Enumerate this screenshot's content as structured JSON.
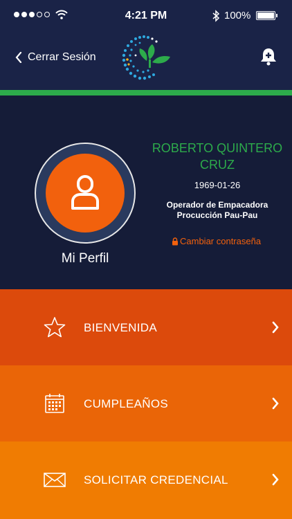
{
  "status_bar": {
    "time": "4:21 PM",
    "battery_percent": "100%",
    "signal_bars": 3
  },
  "nav": {
    "back_label": "Cerrar Sesión",
    "logo_icon": "logo-dots-leaf",
    "bell_icon": "bell-plus-icon"
  },
  "profile": {
    "name": "ROBERTO QUINTERO CRUZ",
    "birth_date": "1969-01-26",
    "job_line1": "Operador de Empacadora",
    "job_line2": "Procucción Pau-Pau",
    "change_password": "Cambiar contraseña",
    "profile_label": "Mi Perfil",
    "avatar_icon": "user-icon"
  },
  "menu": {
    "items": [
      {
        "label": "BIENVENIDA",
        "icon": "star-icon"
      },
      {
        "label": "CUMPLEAÑOS",
        "icon": "calendar-icon"
      },
      {
        "label": "SOLICITAR CREDENCIAL",
        "icon": "envelope-icon"
      }
    ]
  },
  "colors": {
    "navy": "#1a2347",
    "green": "#2dab4b",
    "orange": "#f2610d",
    "menu1": "#dc4a0c",
    "menu2": "#ea6507",
    "menu3": "#f07c02"
  }
}
